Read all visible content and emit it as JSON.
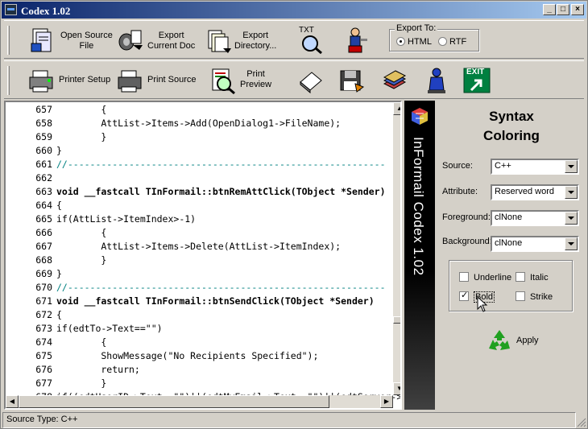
{
  "window": {
    "title": "Codex 1.02"
  },
  "toolbar1": {
    "open_source_file": "Open Source\nFile",
    "export_current_doc": "Export\nCurrent Doc",
    "export_directory": "Export\nDirectory...",
    "txt_badge": "TXT",
    "export_to": {
      "legend": "Export To:",
      "options": [
        "HTML",
        "RTF"
      ],
      "selected": "HTML"
    }
  },
  "toolbar2": {
    "printer_setup": "Printer Setup",
    "print_source": "Print Source",
    "print_preview": "Print\nPreview",
    "exit_label": "EXIT"
  },
  "editor": {
    "lines": [
      {
        "num": "657",
        "text": "        {"
      },
      {
        "num": "658",
        "text": "        AttList->Items->Add(OpenDialog1->FileName);"
      },
      {
        "num": "659",
        "text": "        }"
      },
      {
        "num": "660",
        "text": "}"
      },
      {
        "num": "661",
        "text": "//---------------------------------------------------------"
      },
      {
        "num": "662",
        "text": ""
      },
      {
        "num": "663",
        "text": "void __fastcall TInFormail::btnRemAttClick(TObject *Sender)"
      },
      {
        "num": "664",
        "text": "{"
      },
      {
        "num": "665",
        "text": "if(AttList->ItemIndex>-1)"
      },
      {
        "num": "666",
        "text": "        {"
      },
      {
        "num": "667",
        "text": "        AttList->Items->Delete(AttList->ItemIndex);"
      },
      {
        "num": "668",
        "text": "        }"
      },
      {
        "num": "669",
        "text": "}"
      },
      {
        "num": "670",
        "text": "//---------------------------------------------------------"
      },
      {
        "num": "671",
        "text": "void __fastcall TInFormail::btnSendClick(TObject *Sender)"
      },
      {
        "num": "672",
        "text": "{"
      },
      {
        "num": "673",
        "text": "if(edtTo->Text==\"\")"
      },
      {
        "num": "674",
        "text": "        {"
      },
      {
        "num": "675",
        "text": "        ShowMessage(\"No Recipients Specified\");"
      },
      {
        "num": "676",
        "text": "        return;"
      },
      {
        "num": "677",
        "text": "        }"
      },
      {
        "num": "678",
        "text": "if((edtUserID->Text==\"\")||(edtMyEmail->Text==\"\")||(edtServer->Text==\"\"))"
      }
    ]
  },
  "banner": {
    "text": "InFormail Codex 1.02"
  },
  "syntax_panel": {
    "heading": "Syntax\nColoring",
    "source_label": "Source:",
    "source_value": "C++",
    "attribute_label": "Attribute:",
    "attribute_value": "Reserved word",
    "foreground_label": "Foreground:",
    "foreground_value": "clNone",
    "background_label": "Background:",
    "background_value": "clNone",
    "underline": "Underline",
    "italic": "Italic",
    "bold": "Bold",
    "strike": "Strike",
    "apply": "Apply"
  },
  "status": {
    "text": "Source Type:  C++"
  },
  "colors": {
    "title_start": "#0a246a",
    "title_end": "#a6caf0",
    "face": "#d4d0c8",
    "comment": "#008080"
  }
}
